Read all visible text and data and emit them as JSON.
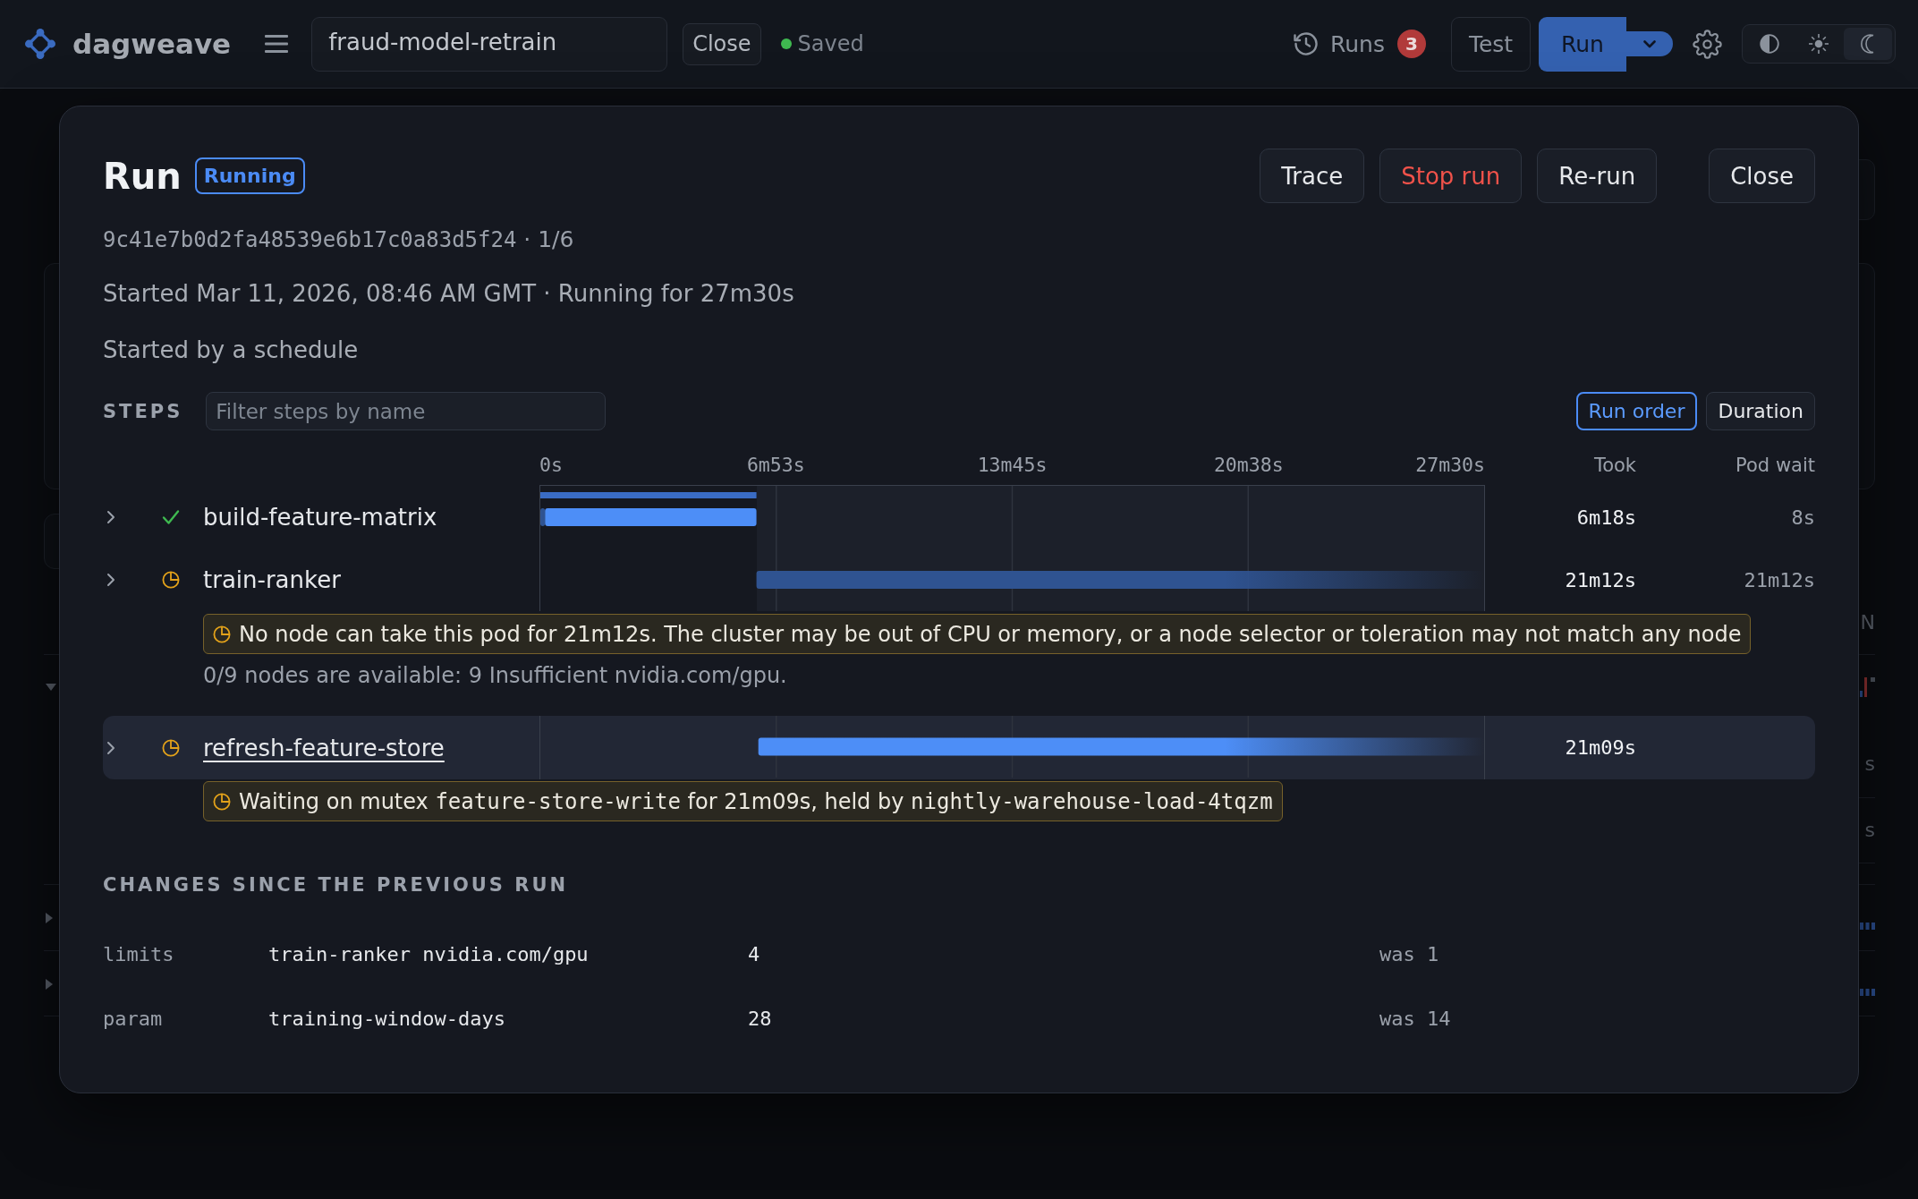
{
  "topbar": {
    "brand": "dagweave",
    "pipeline_name": "fraud-model-retrain",
    "close_label": "Close",
    "save_status": {
      "label": "Saved",
      "saved": true
    },
    "runs": {
      "label": "Runs",
      "count": "3"
    },
    "test_label": "Test",
    "run_label": "Run",
    "theme_options": [
      {
        "kind": "auto",
        "selected": false
      },
      {
        "kind": "light",
        "selected": false
      },
      {
        "kind": "dark",
        "selected": true
      }
    ]
  },
  "background_page": {
    "column_header": "N",
    "rows": [
      {
        "expanded": true,
        "cells": [
          "s",
          "s"
        ]
      },
      {
        "expanded": false
      },
      {
        "expanded": false
      }
    ]
  },
  "run_dialog": {
    "title": "Run",
    "status": {
      "label": "Running",
      "kind": "running"
    },
    "actions": [
      {
        "label": "Trace",
        "kind": "default"
      },
      {
        "label": "Stop run",
        "kind": "danger"
      },
      {
        "label": "Re-run",
        "kind": "default"
      },
      {
        "label": "Close",
        "kind": "close"
      }
    ],
    "id_line": [
      {
        "kind": "code",
        "text": "9c41e7b0d2fa48539e6b17c0a83d5f24"
      },
      {
        "kind": "text",
        "text": " · 1/6"
      }
    ],
    "started": "Started Mar 11, 2026, 08:46 AM GMT · Running for 27m30s",
    "trigger": "Started by a schedule",
    "steps": {
      "title": "STEPS",
      "filter": {
        "placeholder": "Filter steps by name"
      },
      "sort_options": [
        {
          "label": "Run order",
          "selected": true
        },
        {
          "label": "Duration",
          "selected": false
        }
      ],
      "columns": {
        "took": "Took",
        "pod_wait": "Pod wait"
      },
      "timeline": {
        "axis_labels": [
          "0s",
          "6m53s",
          "13m45s",
          "20m38s",
          "27m30s"
        ]
      },
      "rows": [
        {
          "name": "build-feature-matrix",
          "kind": "succeeded",
          "expanded": false,
          "selected": false,
          "took": "6m18s",
          "pod_wait": "8s"
        },
        {
          "name": "train-ranker",
          "kind": "waiting",
          "expanded": false,
          "selected": false,
          "took": "21m12s",
          "pod_wait": "21m12s",
          "notice": [
            {
              "kind": "text",
              "text": "No node can take this pod for 21m12s. The cluster may be out of CPU or memory, or a node selector or toleration may not match any node"
            }
          ],
          "detail": "0/9 nodes are available: 9 Insufficient nvidia.com/gpu."
        },
        {
          "name": "refresh-feature-store",
          "kind": "waiting",
          "expanded": false,
          "selected": true,
          "took": "21m09s",
          "notice": [
            {
              "kind": "text",
              "text": "Waiting on mutex "
            },
            {
              "kind": "code",
              "text": "feature-store-write"
            },
            {
              "kind": "text",
              "text": " for 21m09s, held by "
            },
            {
              "kind": "code",
              "text": "nightly-warehouse-load-4tqzm"
            }
          ]
        }
      ]
    },
    "changes": {
      "title": "CHANGES SINCE THE PREVIOUS RUN",
      "rows": [
        {
          "category": "limits",
          "key": "train-ranker nvidia.com/gpu",
          "value": "4",
          "previous": "was 1"
        },
        {
          "category": "param",
          "key": "training-window-days",
          "value": "28",
          "previous": "was 14"
        }
      ]
    }
  }
}
